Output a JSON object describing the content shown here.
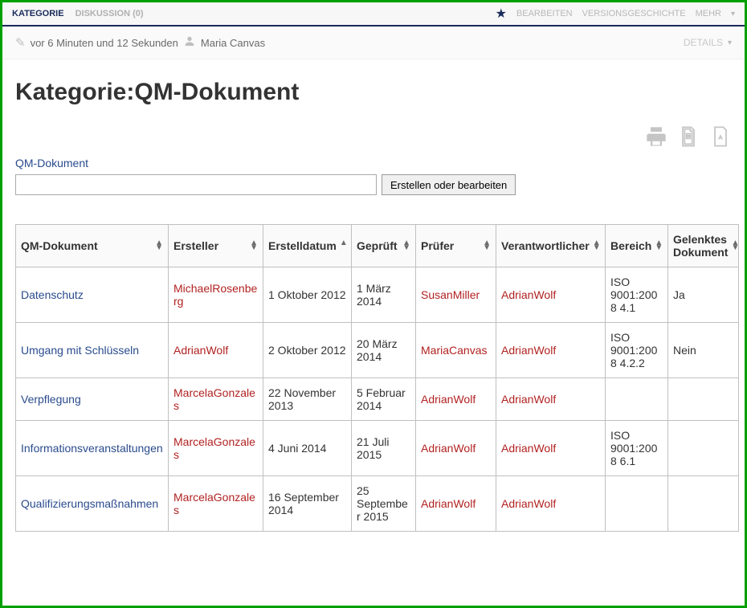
{
  "topnav": {
    "tabs": [
      {
        "label": "KATEGORIE",
        "active": true
      },
      {
        "label": "DISKUSSION (0)",
        "active": false
      }
    ],
    "actions": {
      "bearbeiten": "BEARBEITEN",
      "geschichte": "VERSIONSGESCHICHTE",
      "mehr": "MEHR"
    }
  },
  "infobar": {
    "timestamp": "vor 6 Minuten und 12 Sekunden",
    "user": "Maria Canvas",
    "details": "DETAILS"
  },
  "page_title": "Kategorie:QM-Dokument",
  "link_label": "QM-Dokument",
  "create_button": "Erstellen oder bearbeiten",
  "table": {
    "headers": {
      "doc": "QM-Dokument",
      "ersteller": "Ersteller",
      "erstelldatum": "Erstelldatum",
      "geprueft": "Geprüft",
      "pruefer": "Prüfer",
      "verantw": "Verantwortlicher",
      "bereich": "Bereich",
      "gelenkt": "Gelenktes Dokument"
    },
    "rows": [
      {
        "doc": "Datenschutz",
        "ersteller": "MichaelRosenberg",
        "erstelldatum": "1 Oktober 2012",
        "geprueft": "1 März 2014",
        "pruefer": "SusanMiller",
        "verantw": "AdrianWolf",
        "bereich": "ISO 9001:2008 4.1",
        "gelenkt": "Ja"
      },
      {
        "doc": "Umgang mit Schlüsseln",
        "ersteller": "AdrianWolf",
        "erstelldatum": "2 Oktober 2012",
        "geprueft": "20 März 2014",
        "pruefer": "MariaCanvas",
        "verantw": "AdrianWolf",
        "bereich": "ISO 9001:2008 4.2.2",
        "gelenkt": "Nein"
      },
      {
        "doc": "Verpflegung",
        "ersteller": "MarcelaGonzales",
        "erstelldatum": "22 November 2013",
        "geprueft": "5 Februar 2014",
        "pruefer": "AdrianWolf",
        "verantw": "AdrianWolf",
        "bereich": "",
        "gelenkt": ""
      },
      {
        "doc": "Informationsveranstaltungen",
        "ersteller": "MarcelaGonzales",
        "erstelldatum": "4 Juni 2014",
        "geprueft": "21 Juli 2015",
        "pruefer": "AdrianWolf",
        "verantw": "AdrianWolf",
        "bereich": "ISO 9001:2008 6.1",
        "gelenkt": ""
      },
      {
        "doc": "Qualifizierungsmaßnahmen",
        "ersteller": "MarcelaGonzales",
        "erstelldatum": "16 September 2014",
        "geprueft": "25 September 2015",
        "pruefer": "AdrianWolf",
        "verantw": "AdrianWolf",
        "bereich": "",
        "gelenkt": ""
      }
    ]
  }
}
